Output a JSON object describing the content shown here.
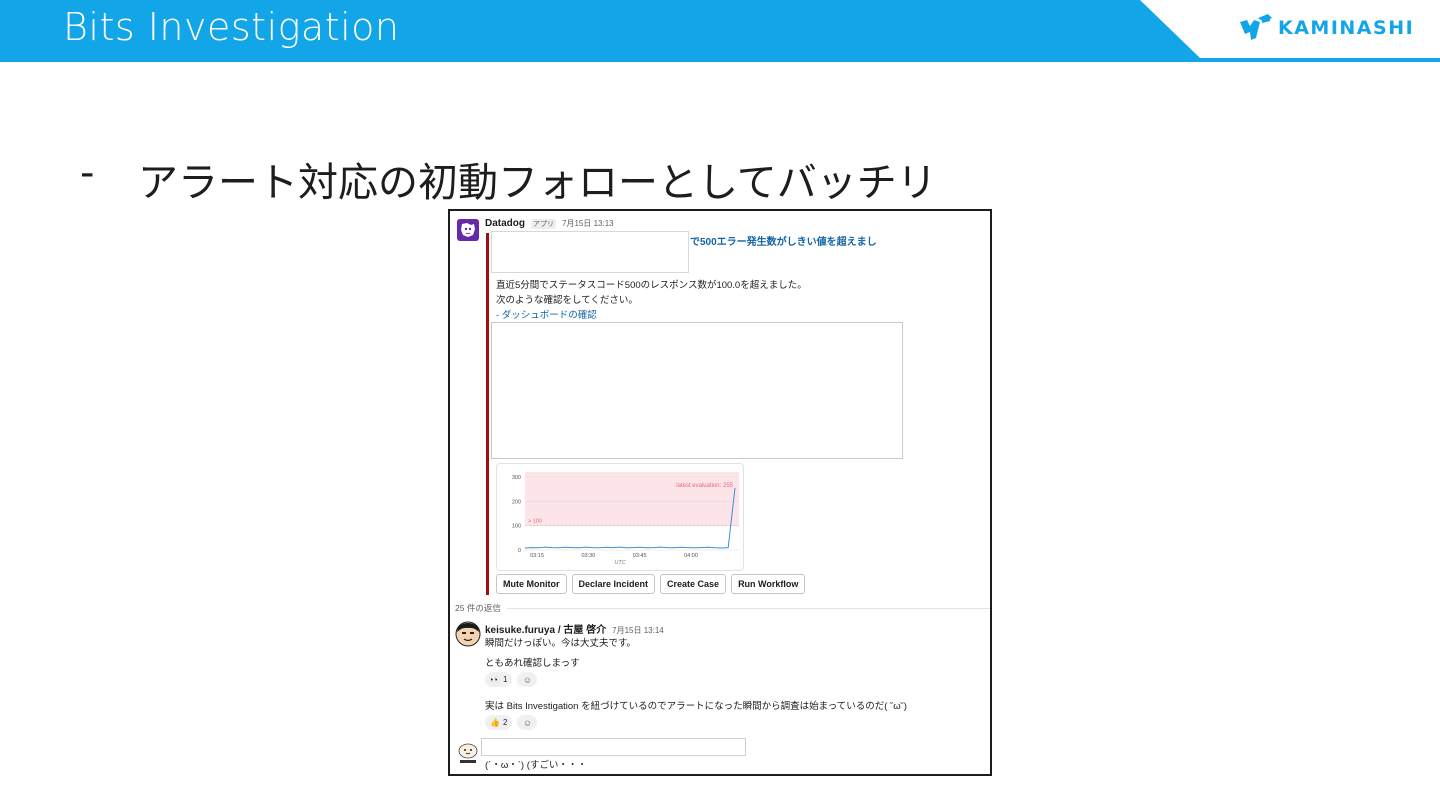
{
  "slide": {
    "title": "Bits Investigation",
    "logo_text": "KAMINASHI",
    "brand_color": "#12a5e8",
    "bullet_marker": "-",
    "bullet_text": "アラート対応の初動フォローとしてバッチリ"
  },
  "alert_message": {
    "sender": "Datadog",
    "app_tag": "アプリ",
    "timestamp": "7月15日 13:13",
    "title_visible": "で500エラー発生数がしきい値を超えまし",
    "body": [
      "直近5分間でステータスコード500のレスポンス数が100.0を超えました。",
      "次のような確認をしてください。"
    ],
    "dashboard_link": "- ダッシュボードの確認",
    "attachment_color": "#a40d0d"
  },
  "chart_data": {
    "type": "line",
    "title": "",
    "xlabel": "UTC",
    "ylabel": "",
    "x_ticks": [
      "03:15",
      "03:30",
      "03:45",
      "04:00"
    ],
    "y_ticks": [
      0,
      100,
      200,
      300
    ],
    "ylim": [
      0,
      320
    ],
    "threshold": 100,
    "threshold_label": "> 100",
    "annotation": "latest evaluation: 255",
    "series": [
      {
        "values": [
          8,
          10,
          9,
          12,
          10,
          9,
          11,
          10,
          9,
          12,
          10,
          9,
          11,
          10,
          12,
          9,
          10,
          11,
          9,
          10,
          12,
          10,
          9,
          11,
          10,
          9,
          10,
          11,
          9,
          8,
          10,
          255
        ]
      }
    ],
    "grid": true
  },
  "actions": [
    {
      "label": "Mute Monitor"
    },
    {
      "label": "Declare Incident"
    },
    {
      "label": "Create Case"
    },
    {
      "label": "Run Workflow"
    }
  ],
  "thread": {
    "replies_label": "25 件の返信",
    "reply": {
      "sender": "keisuke.furuya / 古屋 啓介",
      "timestamp": "7月15日 13:14",
      "lines": [
        "瞬間だけっぽい。今は大丈夫です。",
        "ともあれ確認しまっす",
        "実は Bits Investigation を紐づけているのでアラートになった瞬間から調査は始まっているのだ( ˘ω˘)"
      ],
      "reactions_1": [
        {
          "emoji": "👀",
          "count": "1"
        }
      ],
      "reactions_2": [
        {
          "emoji": "👍",
          "count": "2"
        }
      ]
    },
    "last_reply": "(´・ω・`) (すごい・・・"
  }
}
